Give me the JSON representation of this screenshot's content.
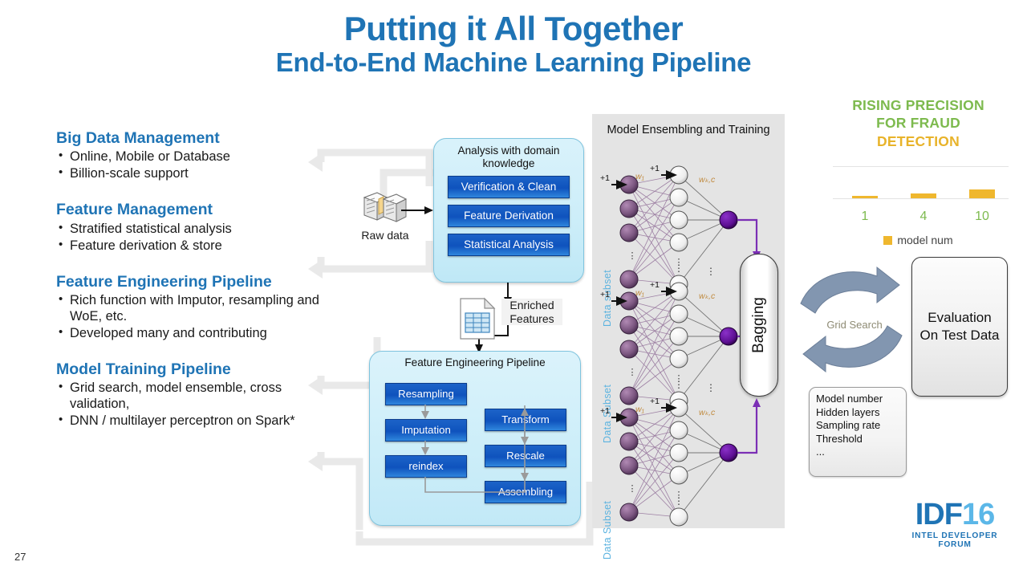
{
  "title": {
    "line1": "Putting it All Together",
    "line2": "End-to-End Machine Learning Pipeline",
    "color": "#1F74B5"
  },
  "sections": [
    {
      "heading": "Big Data Management",
      "bullets": [
        "Online, Mobile or Database",
        "Billion-scale support"
      ]
    },
    {
      "heading": "Feature Management",
      "bullets": [
        "Stratified statistical analysis",
        "Feature derivation & store"
      ]
    },
    {
      "heading": "Feature Engineering Pipeline",
      "bullets": [
        "Rich function with Imputor, resampling and WoE, etc.",
        "Developed many and contributing"
      ]
    },
    {
      "heading": "Model Training Pipeline",
      "bullets": [
        "Grid search, model ensemble, cross validation,",
        "DNN / multilayer perceptron on Spark*"
      ]
    }
  ],
  "raw_data": {
    "label": "Raw data"
  },
  "analysis_box": {
    "title": "Analysis with domain knowledge",
    "buttons": [
      "Verification & Clean",
      "Feature Derivation",
      "Statistical Analysis"
    ]
  },
  "enriched": {
    "label": "Enriched Features"
  },
  "feature_engineering_box": {
    "title": "Feature Engineering Pipeline",
    "left_column": [
      "Resampling",
      "Imputation",
      "reindex"
    ],
    "right_column": [
      "Transform",
      "Rescale",
      "Assembling"
    ]
  },
  "ensembling": {
    "title": "Model Ensembling and Training",
    "subset_labels": [
      "Data subset",
      "Data Subset",
      "Data Subset"
    ],
    "bias_label": "+1",
    "weight_labels": [
      "w₁",
      "wₖ,ᴄ"
    ],
    "bagging_label": "Bagging"
  },
  "chart_data": {
    "type": "bar",
    "title": "RISING PRECISION FOR FRAUD DETECTION",
    "title_lines": [
      "RISING PRECISION",
      "FOR FRAUD",
      "DETECTION"
    ],
    "categories": [
      "1",
      "4",
      "10"
    ],
    "values": [
      2,
      5,
      9
    ],
    "series": [
      {
        "name": "model num",
        "values": [
          2,
          5,
          9
        ]
      }
    ],
    "xlabel": "",
    "ylabel": "",
    "ylim": [
      0,
      12
    ],
    "legend": [
      "model num"
    ],
    "legend_position": "bottom",
    "grid": true,
    "bar_color": "#EFB72E",
    "title_colors": [
      "#7DBA4E",
      "#7DBA4E",
      "#E8B32A"
    ],
    "tick_label_color": "#7DBA4E"
  },
  "grid_search": {
    "label": "Grid Search"
  },
  "evaluation": {
    "line1": "Evaluation",
    "line2": "On Test Data"
  },
  "params": {
    "items": [
      "Model number",
      "Hidden layers",
      "Sampling rate",
      "Threshold",
      "..."
    ]
  },
  "footer": {
    "page_number": "27",
    "logo_main_a": "IDF",
    "logo_main_b": "16",
    "logo_sub": "INTEL DEVELOPER FORUM"
  }
}
